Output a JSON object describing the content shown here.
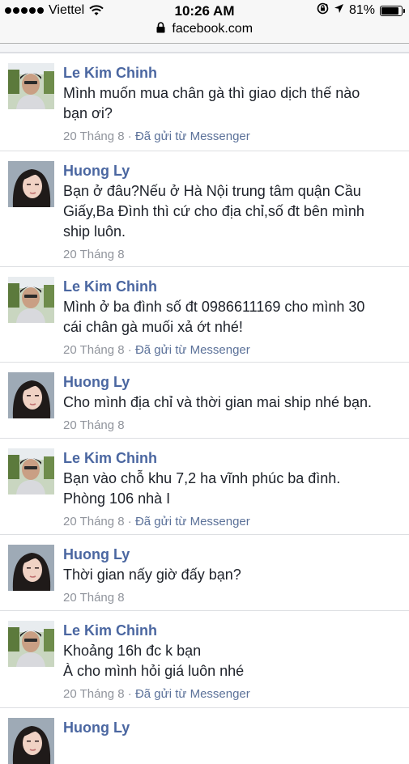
{
  "status_bar": {
    "carrier": "Viettel",
    "time": "10:26 AM",
    "battery_percent": "81%",
    "battery_level": 0.81,
    "icons": [
      "signal-dots-icon",
      "wifi-icon",
      "rotation-lock-icon",
      "location-arrow-icon",
      "battery-icon"
    ]
  },
  "url_bar": {
    "domain": "facebook.com",
    "icon": "lock-icon"
  },
  "messages": [
    {
      "sender": "Le Kim Chinh",
      "text": "Mình muốn mua chân gà thì giao dịch thế nào\nbạn ơi?",
      "date": "20 Tháng 8",
      "separator": " · ",
      "source": "Đã gửi từ Messenger"
    },
    {
      "sender": "Huong Ly",
      "text": "Bạn ở đâu?Nếu ở Hà Nội trung tâm quận Cầu\nGiấy,Ba Đình thì cứ cho địa chỉ,số đt bên mình\nship luôn.",
      "date": "20 Tháng 8",
      "separator": "",
      "source": ""
    },
    {
      "sender": "Le Kim Chinh",
      "text": "Mình ở ba đình số đt 0986611169 cho mình 30\ncái chân gà muối xả ớt nhé!",
      "date": "20 Tháng 8",
      "separator": " · ",
      "source": "Đã gửi từ Messenger"
    },
    {
      "sender": "Huong Ly",
      "text": "Cho mình địa chỉ và thời gian mai ship nhé bạn.",
      "date": "20 Tháng 8",
      "separator": "",
      "source": ""
    },
    {
      "sender": "Le Kim Chinh",
      "text": "Bạn vào chỗ khu 7,2 ha vĩnh phúc ba đình.\nPhòng 106 nhà I",
      "date": "20 Tháng 8",
      "separator": " · ",
      "source": "Đã gửi từ Messenger"
    },
    {
      "sender": "Huong Ly",
      "text": "Thời gian nấy giờ đấy bạn?",
      "date": "20 Tháng 8",
      "separator": "",
      "source": ""
    },
    {
      "sender": "Le Kim Chinh",
      "text": "Khoảng 16h đc k bạn\nÀ cho mình hỏi giá luôn nhé",
      "date": "20 Tháng 8",
      "separator": " · ",
      "source": "Đã gửi từ Messenger"
    },
    {
      "sender": "Huong Ly",
      "text": "",
      "date": "",
      "separator": "",
      "source": ""
    }
  ]
}
